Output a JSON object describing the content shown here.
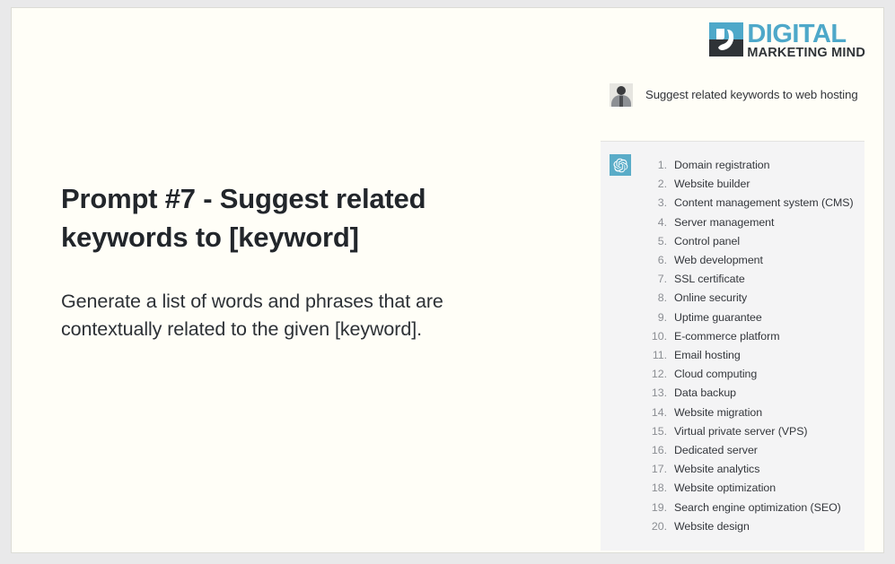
{
  "brand": {
    "title": "DIGITAL",
    "subtitle": "MARKETING MIND",
    "title_color": "#4ea8c9",
    "subtitle_color": "#2f3337"
  },
  "prompt": {
    "heading": "Prompt #7 - Suggest related keywords to [keyword]",
    "body": "Generate a list of words and phrases that are contextually related to the given [keyword]."
  },
  "chat": {
    "user": {
      "avatar": "user-photo-avatar",
      "message": "Suggest related keywords to web hosting"
    },
    "assistant": {
      "avatar": "chatgpt-icon",
      "avatar_bg": "#5aacc8",
      "items": [
        "Domain registration",
        "Website builder",
        "Content management system (CMS)",
        "Server management",
        "Control panel",
        "Web development",
        "SSL certificate",
        "Online security",
        "Uptime guarantee",
        "E-commerce platform",
        "Email hosting",
        "Cloud computing",
        "Data backup",
        "Website migration",
        "Virtual private server (VPS)",
        "Dedicated server",
        "Website analytics",
        "Website optimization",
        "Search engine optimization (SEO)",
        "Website design"
      ]
    }
  }
}
